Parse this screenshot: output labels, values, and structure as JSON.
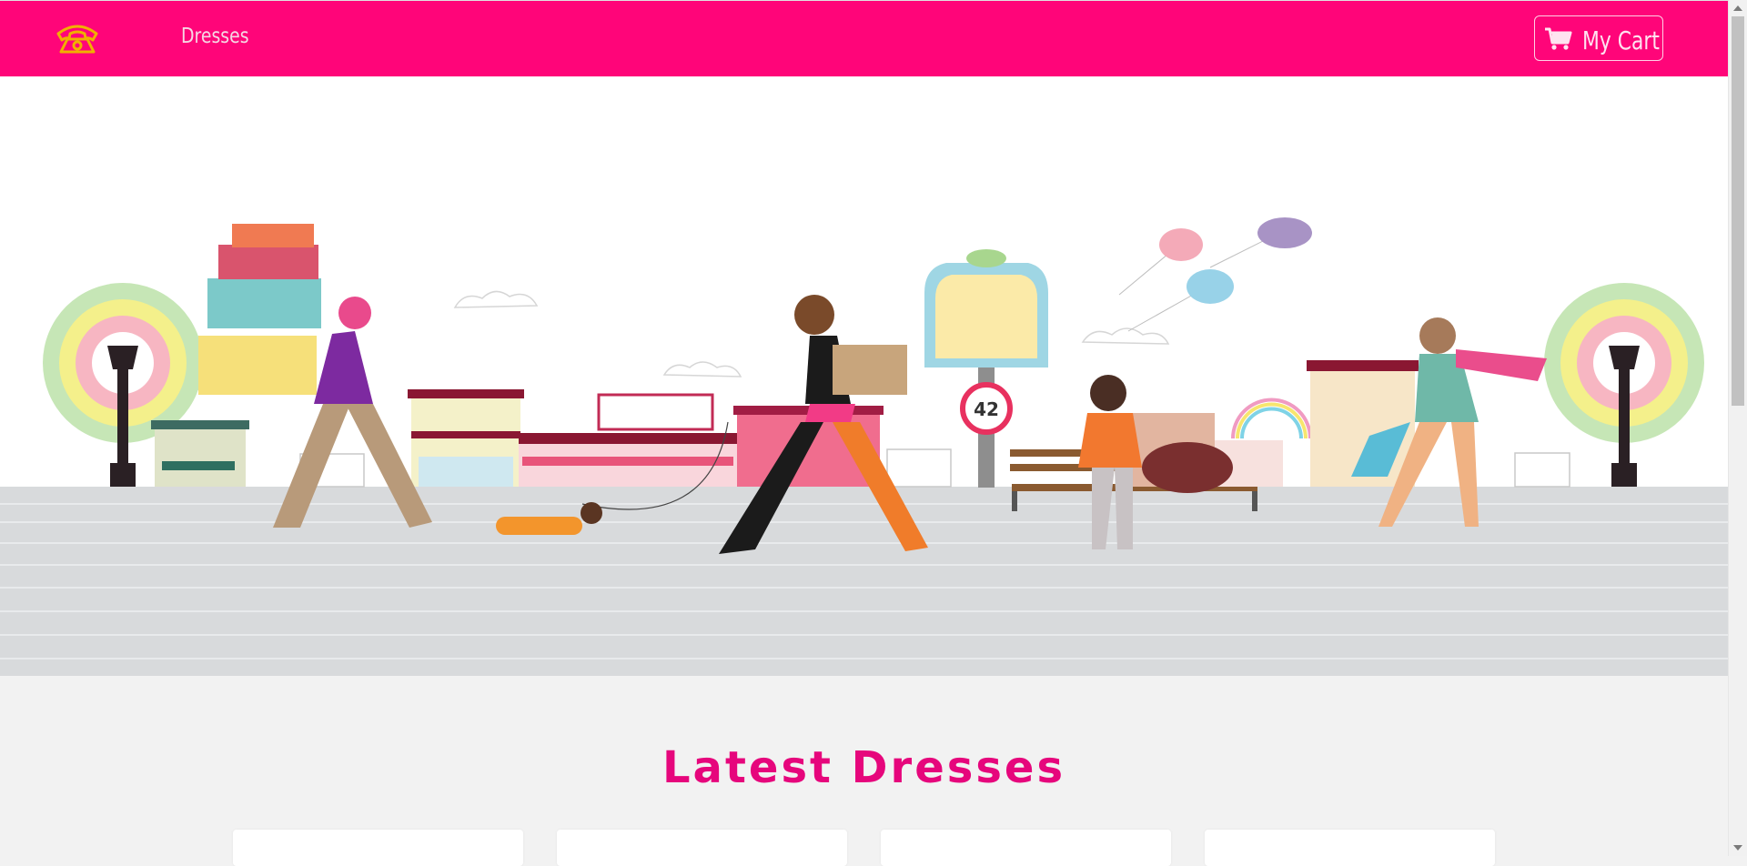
{
  "navbar": {
    "phone_icon": "telephone-icon",
    "link_label": "Dresses",
    "cart_icon": "shopping-cart-icon",
    "cart_label": "My Cart",
    "background_color": "#ff0579"
  },
  "hero": {
    "illustration": "city-shopping-street-illustration",
    "sign_number": "42"
  },
  "section": {
    "title": "Latest Dresses",
    "title_color": "#e6067c"
  },
  "products": [
    {
      "name": ""
    },
    {
      "name": ""
    },
    {
      "name": ""
    },
    {
      "name": ""
    }
  ]
}
